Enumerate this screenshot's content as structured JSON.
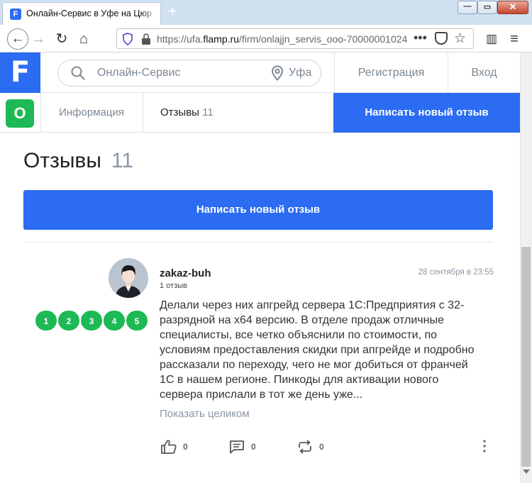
{
  "browser": {
    "tab_title": "Онлайн-Сервис в Уфе на Цюр",
    "new_tab_label": "+",
    "url_prefix": "https://ufa.",
    "url_domain": "flamp.ru",
    "url_path": "/firm/onlajjn_servis_ooo-70000001024",
    "window_min": "—",
    "window_max": "▭",
    "window_close": "✕"
  },
  "header": {
    "logo": "F",
    "search_placeholder": "Онлайн-Сервис",
    "city": "Уфа",
    "register": "Регистрация",
    "login": "Вход"
  },
  "subnav": {
    "badge": "О",
    "info": "Информация",
    "reviews": "Отзывы",
    "reviews_count": "11",
    "write": "Написать новый отзыв"
  },
  "main": {
    "title": "Отзывы",
    "title_count": "11",
    "write_button": "Написать новый отзыв"
  },
  "review": {
    "author": "zakaz-buh",
    "author_reviews": "1 отзыв",
    "date": "28 сентября в 23:55",
    "rating": [
      "1",
      "2",
      "3",
      "4",
      "5"
    ],
    "text": "Делали через них апгрейд сервера 1С:Предприятия с 32-разрядной на x64 версию. В отделе продаж отличные специалисты, все четко объяснили по стоимости, по условиям предоставления скидки при апгрейде и подробно рассказали по переходу, чего не мог добиться от франчей 1С в нашем регионе. Пинкоды для активации нового сервера прислали в тот же день уже...",
    "show_all": "Показать целиком",
    "likes": "0",
    "comments": "0",
    "shares": "0"
  },
  "colors": {
    "brand": "#2b6cf2",
    "rating_green": "#1db954",
    "muted": "#8b96a3"
  }
}
